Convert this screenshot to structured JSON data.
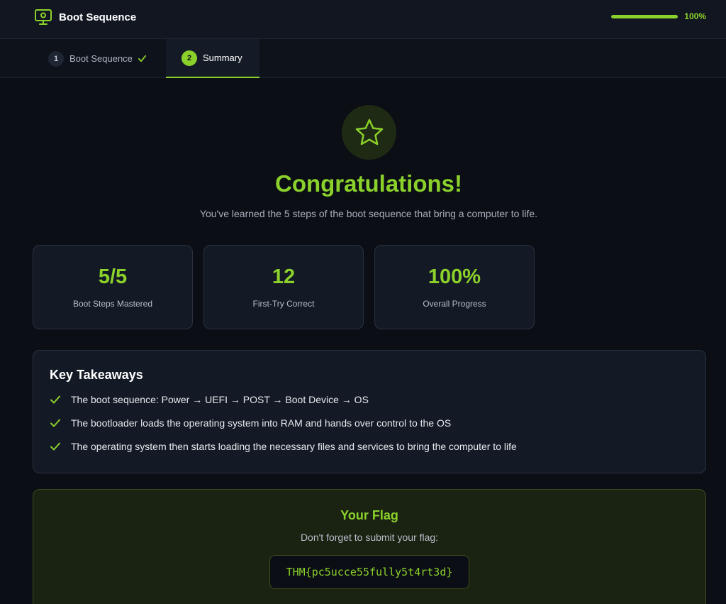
{
  "header": {
    "title": "Boot Sequence",
    "progress_fraction": 1.0,
    "progress_text": "100%",
    "accent_color": "#8bd12b"
  },
  "tabs": [
    {
      "number": "1",
      "label": "Boot Sequence",
      "completed": true,
      "icon": "check-icon"
    },
    {
      "number": "2",
      "label": "Summary",
      "active": true
    }
  ],
  "hero": {
    "icon": "star-icon",
    "title": "Congratulations!",
    "subtitle": "You've learned the 5 steps of the boot sequence that bring a computer to life."
  },
  "stats": [
    {
      "value": "5/5",
      "label": "Boot Steps Mastered"
    },
    {
      "value": "12",
      "label": "First-Try Correct"
    },
    {
      "value": "100%",
      "label": "Overall Progress"
    }
  ],
  "takeaways": {
    "title": "Key Takeaways",
    "items": [
      "The boot sequence: Power → UEFI → POST → Boot Device → OS",
      "The bootloader loads the operating system into RAM and hands over control to the OS",
      "The operating system then starts loading the necessary files and services to bring the computer to life"
    ]
  },
  "flag": {
    "title": "Your Flag",
    "subtitle": "Don't forget to submit your flag:",
    "value": "THM{pc5ucce55fully5t4rt3d}"
  }
}
